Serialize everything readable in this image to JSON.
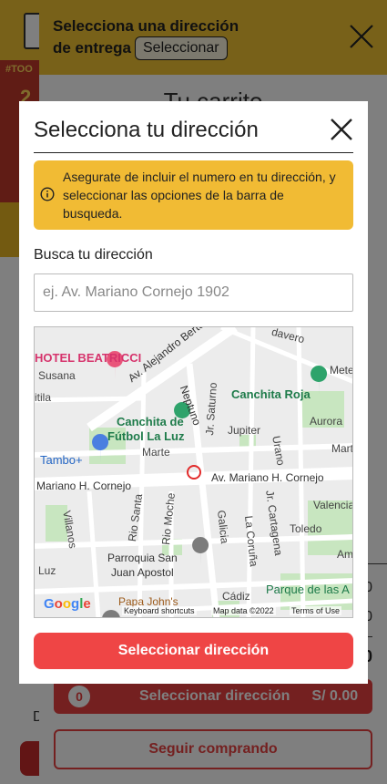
{
  "background": {
    "hero_tag": "#TOO",
    "hero_number": "2",
    "letter": "D"
  },
  "drawer": {
    "title_line1": "Selecciona una dirección",
    "title_line2": "de entrega",
    "select_button": "Seleccionar",
    "cart_title": "Tu carrito",
    "subtotal_value": "0",
    "delivery_value": "0",
    "total_value": "0",
    "checkout": {
      "count": "0",
      "label": "Seleccionar dirección",
      "price": "S/ 0.00"
    },
    "keep_shopping": "Seguir comprando"
  },
  "modal": {
    "title": "Selecciona tu dirección",
    "notice": "Asegurate de incluir el numero en tu dirección, y seleccionar las opciones de la barra de busqueda.",
    "search_label": "Busca tu dirección",
    "search_placeholder": "ej. Av. Mariano Cornejo 1902",
    "search_value": "",
    "select_button": "Seleccionar dirección",
    "map": {
      "labels": {
        "hotel": "HOTEL BEATRICCI",
        "susana": "Susana",
        "itila": "itila",
        "alejandro": "Av. Alejandro Bertello",
        "neptuno": "Neptuno",
        "davero": "davero",
        "mete": "Mete",
        "canchita_roja": "Canchita Roja",
        "aurora": "Aurora",
        "canchita_futbol_1": "Canchita de",
        "canchita_futbol_2": "Fútbol La Luz",
        "jupiter": "Jupiter",
        "marte": "Marte",
        "urano": "Urano",
        "mart": "Mart",
        "saturno": "Jr. Saturno",
        "tambo": "Tambo+",
        "mariano1": "Mariano H. Cornejo",
        "mariano2": "Av. Mariano H. Cornejo",
        "cartagena": "Jr. Cartagena",
        "valencia": "Valencia",
        "villanos": "Villanos",
        "rio_santa": "Rio Santa",
        "rio_moche": "Rio Moche",
        "galicia": "Galicia",
        "la_coruna": "La Coruña",
        "toledo": "Toledo",
        "am": "Am",
        "parroquia1": "Parroquia San",
        "parroquia2": "Juan Apostol",
        "luz": "Luz",
        "parque": "Parque de las A",
        "papa_johns": "Papa John's",
        "cadiz": "Cádiz"
      },
      "google": "Google",
      "keyboard_shortcuts": "Keyboard shortcuts",
      "map_data": "Map data ©2022",
      "terms": "Terms of Use"
    }
  },
  "colors": {
    "yellow": "#f1c232",
    "notice_yellow": "#f1bb34",
    "red": "#ef4545",
    "park_green": "#c8e6c0",
    "map_bg": "#ececec"
  }
}
